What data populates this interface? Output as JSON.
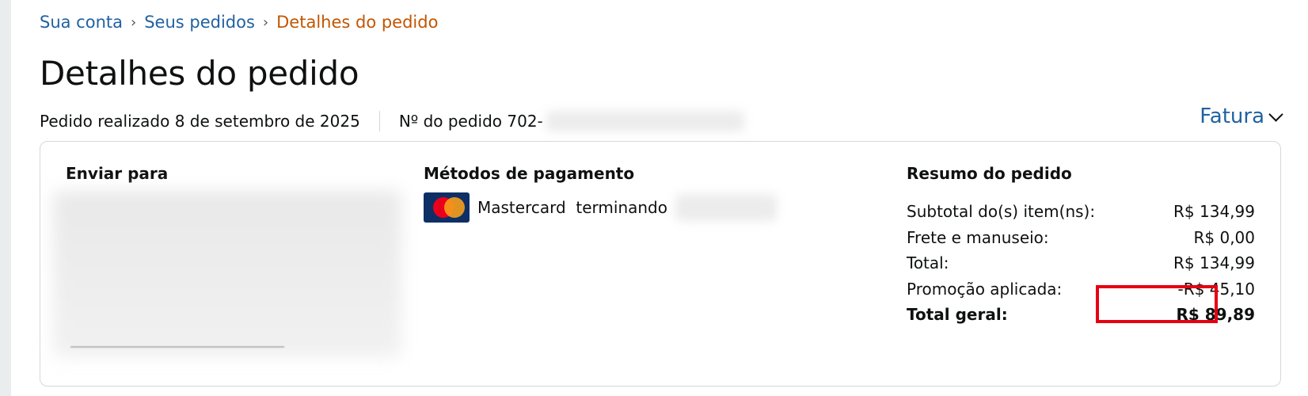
{
  "breadcrumb": {
    "items": [
      "Sua conta",
      "Seus pedidos"
    ],
    "current": "Detalhes do pedido",
    "separator": "›"
  },
  "page_title": "Detalhes do pedido",
  "order_meta": {
    "placed": "Pedido realizado 8 de setembro de 2025",
    "number_prefix": "Nº do pedido 702-"
  },
  "invoice": {
    "label": "Fatura"
  },
  "shipping": {
    "heading": "Enviar para"
  },
  "payment": {
    "heading": "Métodos de pagamento",
    "card_label": "Mastercard  terminando",
    "card_brand_icon": "mastercard-icon"
  },
  "summary": {
    "heading": "Resumo do pedido",
    "rows": [
      {
        "label": "Subtotal do(s) item(ns):",
        "value": "R$ 134,99"
      },
      {
        "label": "Frete e manuseio:",
        "value": "R$ 0,00"
      },
      {
        "label": "Total:",
        "value": "R$ 134,99"
      },
      {
        "label": "Promoção aplicada:",
        "value": "-R$ 45,10"
      },
      {
        "label": "Total geral:",
        "value": "R$ 89,89"
      }
    ]
  },
  "colors": {
    "link": "#2162a1",
    "current_crumb": "#c45500",
    "highlight": "#e60012"
  }
}
